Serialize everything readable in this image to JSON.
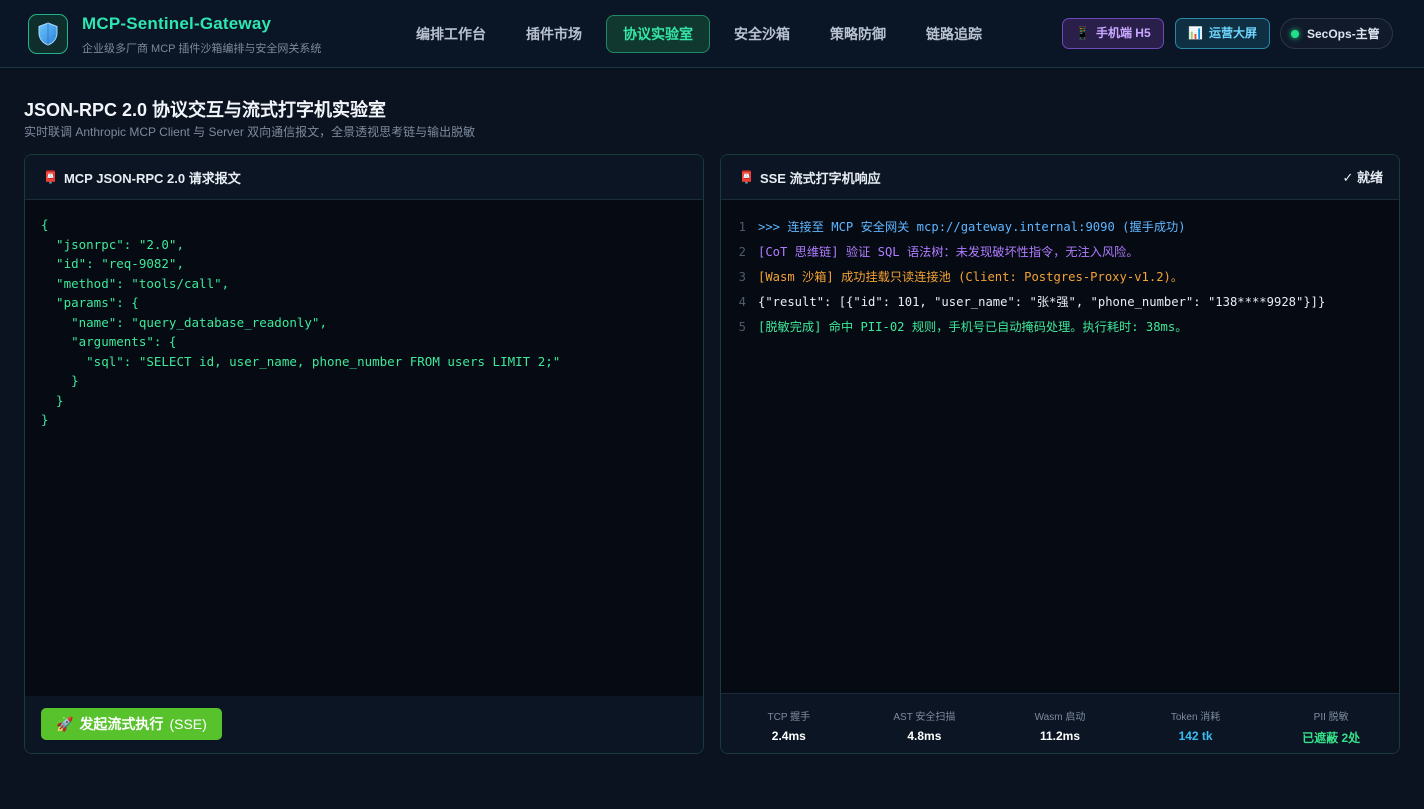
{
  "app": {
    "title": "MCP-Sentinel-Gateway",
    "subtitle": "企业级多厂商 MCP 插件沙箱编排与安全网关系统",
    "logo_icon": "shield-icon"
  },
  "nav": {
    "items": [
      {
        "label": "编排工作台",
        "active": false
      },
      {
        "label": "插件市场",
        "active": false
      },
      {
        "label": "协议实验室",
        "active": true
      },
      {
        "label": "安全沙箱",
        "active": false
      },
      {
        "label": "策略防御",
        "active": false
      },
      {
        "label": "链路追踪",
        "active": false
      }
    ]
  },
  "header_actions": {
    "mobile_icon": "📱",
    "mobile_label": "手机端 H5",
    "dashboard_icon": "📊",
    "dashboard_label": "运营大屏",
    "user_label": "SecOps-主管",
    "user_status": "online"
  },
  "page": {
    "title": "JSON-RPC 2.0 协议交互与流式打字机实验室",
    "subtitle": "实时联调 Anthropic MCP Client 与 Server 双向通信报文，全景透视思考链与输出脱敏"
  },
  "request_panel": {
    "icon": "📮",
    "title": "MCP JSON-RPC 2.0 请求报文",
    "code": "{\n  \"jsonrpc\": \"2.0\",\n  \"id\": \"req-9082\",\n  \"method\": \"tools/call\",\n  \"params\": {\n    \"name\": \"query_database_readonly\",\n    \"arguments\": {\n      \"sql\": \"SELECT id, user_name, phone_number FROM users LIMIT 2;\"\n    }\n  }\n}",
    "run_icon": "🚀",
    "run_label": "发起流式执行",
    "run_label_suffix": "(SSE)"
  },
  "response_panel": {
    "icon": "📮",
    "title": "SSE 流式打字机响应",
    "status": "✓ 就绪",
    "lines": [
      {
        "num": "1",
        "text": ">>> 连接至 MCP 安全网关 mcp://gateway.internal:9090 (握手成功)",
        "kind": "blue"
      },
      {
        "num": "2",
        "text": "[CoT 思维链] 验证 SQL 语法树：未发现破坏性指令，无注入风险。",
        "kind": "purple"
      },
      {
        "num": "3",
        "text": "[Wasm 沙箱] 成功挂载只读连接池 (Client: Postgres-Proxy-v1.2)。",
        "kind": "orange"
      },
      {
        "num": "4",
        "text": "{\"result\": [{\"id\": 101, \"user_name\": \"张*强\", \"phone_number\": \"138****9928\"}]}",
        "kind": "white"
      },
      {
        "num": "5",
        "text": "[脱敏完成] 命中 PII-02 规则，手机号已自动掩码处理。执行耗时: 38ms。",
        "kind": "green"
      }
    ],
    "metrics": [
      {
        "label": "TCP 握手",
        "value": "2.4ms",
        "tone": "white"
      },
      {
        "label": "AST 安全扫描",
        "value": "4.8ms",
        "tone": "white"
      },
      {
        "label": "Wasm 启动",
        "value": "11.2ms",
        "tone": "white"
      },
      {
        "label": "Token 消耗",
        "value": "142 tk",
        "tone": "cyan"
      },
      {
        "label": "PII 脱敏",
        "value": "已遮蔽 2处",
        "tone": "green"
      }
    ]
  },
  "colors": {
    "accent": "#2ee6b0",
    "run_button": "#57c22c",
    "background": "#0b1220"
  }
}
